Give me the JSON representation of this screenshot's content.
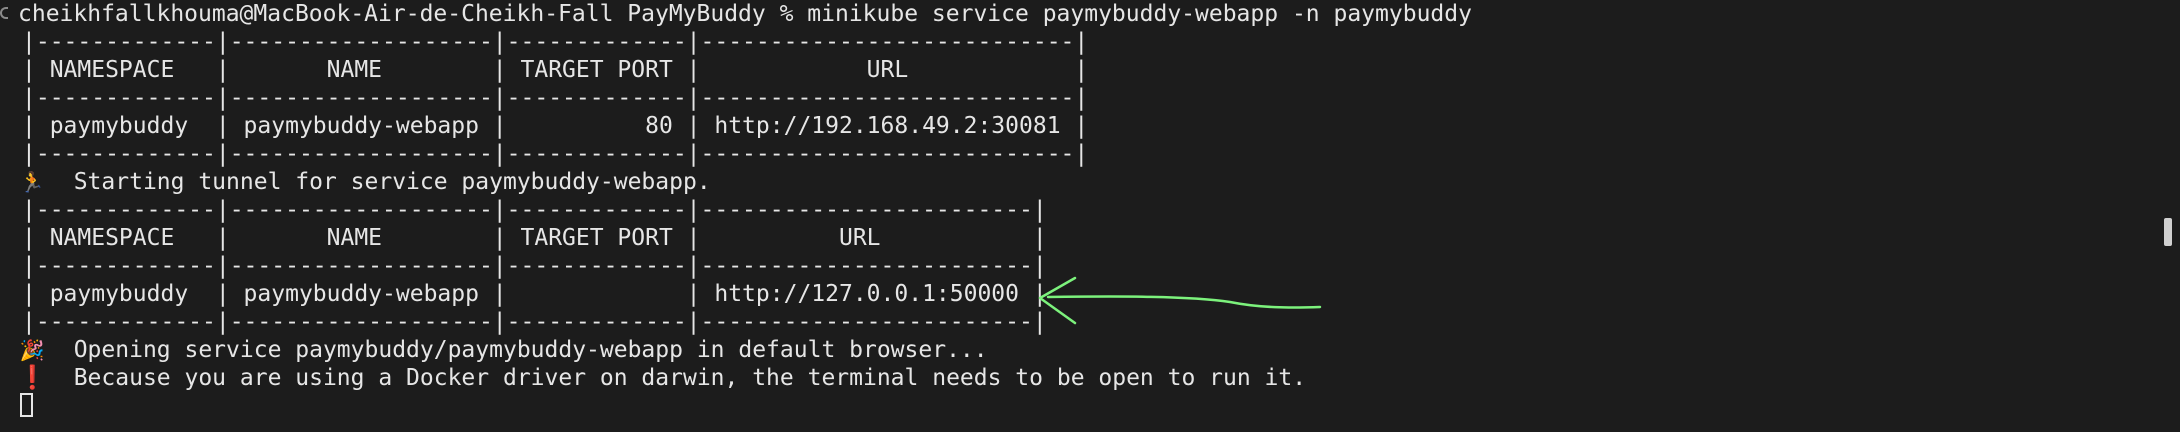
{
  "command_line": "cheikhfallkhouma@MacBook-Air-de-Cheikh-Fall PayMyBuddy % minikube service paymybuddy-webapp -n paymybuddy",
  "table1": {
    "rows": [
      "|-------------|-------------------|-------------|---------------------------|",
      "| NAMESPACE   |       NAME        | TARGET PORT |            URL            |",
      "|-------------|-------------------|-------------|---------------------------|",
      "| paymybuddy  | paymybuddy-webapp |          80 | http://192.168.49.2:30081 |",
      "|-------------|-------------------|-------------|---------------------------|"
    ]
  },
  "tunnel_message": "Starting tunnel for service paymybuddy-webapp.",
  "table2": {
    "rows": [
      "|-------------|-------------------|-------------|------------------------|",
      "| NAMESPACE   |       NAME        | TARGET PORT |          URL           |",
      "|-------------|-------------------|-------------|------------------------|",
      "| paymybuddy  | paymybuddy-webapp |             | http://127.0.0.1:50000 |",
      "|-------------|-------------------|-------------|------------------------|"
    ]
  },
  "opening_message": "Opening service paymybuddy/paymybuddy-webapp in default browser...",
  "warning_message": "Because you are using a Docker driver on darwin, the terminal needs to be open to run it.",
  "icons": {
    "tunnel": "runner-icon",
    "opening": "party-popper-icon",
    "warning": "exclamation-icon"
  },
  "colors": {
    "background": "#1c1c1c",
    "text": "#e6e6e6",
    "annotation_arrow": "#7cf27c",
    "warning": "#e53935"
  }
}
